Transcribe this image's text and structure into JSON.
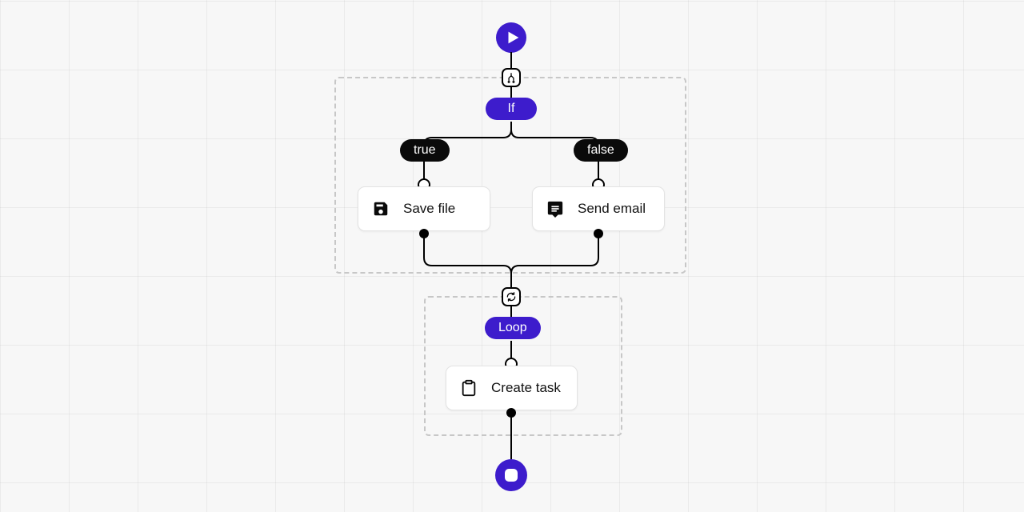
{
  "start": {
    "icon": "play"
  },
  "end": {
    "icon": "stop"
  },
  "if_block": {
    "handle_icon": "branch",
    "label": "If",
    "branches": {
      "true": {
        "label": "true",
        "node": {
          "icon": "save",
          "label": "Save file"
        }
      },
      "false": {
        "label": "false",
        "node": {
          "icon": "message",
          "label": "Send email"
        }
      }
    }
  },
  "loop_block": {
    "handle_icon": "refresh",
    "label": "Loop",
    "node": {
      "icon": "clipboard",
      "label": "Create task"
    }
  }
}
